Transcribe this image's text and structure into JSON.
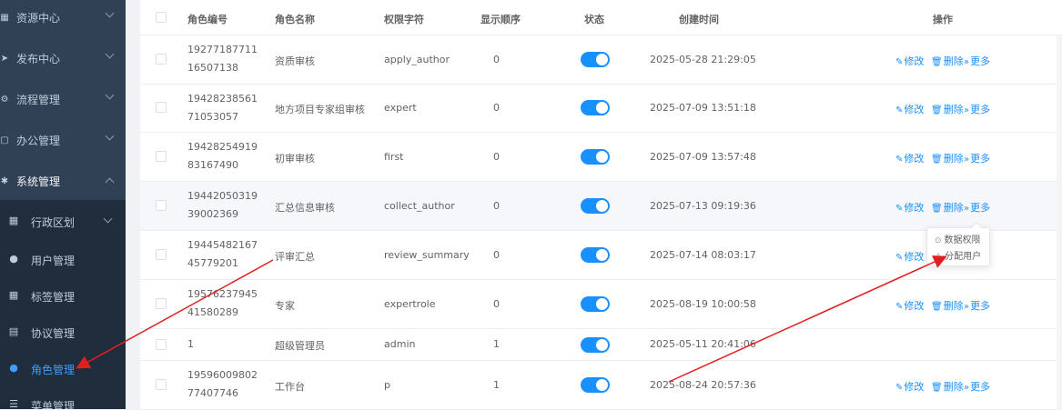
{
  "sidebar": {
    "items": [
      {
        "label": "资源中心",
        "icon": "grid-icon"
      },
      {
        "label": "发布中心",
        "icon": "send-icon"
      },
      {
        "label": "流程管理",
        "icon": "flow-icon"
      },
      {
        "label": "办公管理",
        "icon": "office-icon"
      },
      {
        "label": "系统管理",
        "icon": "gear-icon",
        "expanded": true
      }
    ],
    "sub_items": [
      {
        "label": "行政区划",
        "icon": "grid-icon"
      },
      {
        "label": "用户管理",
        "icon": "user-icon"
      },
      {
        "label": "标签管理",
        "icon": "grid-icon"
      },
      {
        "label": "协议管理",
        "icon": "document-icon"
      },
      {
        "label": "角色管理",
        "icon": "users-icon",
        "active": true
      },
      {
        "label": "菜单管理",
        "icon": "list-icon"
      }
    ]
  },
  "table": {
    "headers": {
      "id": "角色编号",
      "name": "角色名称",
      "key": "权限字符",
      "sort": "显示顺序",
      "status": "状态",
      "created": "创建时间",
      "actions": "操作"
    },
    "rows": [
      {
        "id": "1927718771116507138",
        "name": "资质审核",
        "key": "apply_author",
        "sort": "0",
        "created": "2025-05-28 21:29:05",
        "status_on": true
      },
      {
        "id": "1942823856171053057",
        "name": "地方项目专家组审核",
        "key": "expert",
        "sort": "0",
        "created": "2025-07-09 13:51:18",
        "status_on": true
      },
      {
        "id": "1942825491983167490",
        "name": "初审审核",
        "key": "first",
        "sort": "0",
        "created": "2025-07-09 13:57:48",
        "status_on": true
      },
      {
        "id": "1944205031939002369",
        "name": "汇总信息审核",
        "key": "collect_author",
        "sort": "0",
        "created": "2025-07-13 09:19:36",
        "status_on": true
      },
      {
        "id": "1944548216745779201",
        "name": "评审汇总",
        "key": "review_summary",
        "sort": "0",
        "created": "2025-07-14 08:03:17",
        "status_on": true
      },
      {
        "id": "1957623794541580289",
        "name": "专家",
        "key": "expertrole",
        "sort": "0",
        "created": "2025-08-19 10:00:58",
        "status_on": true
      },
      {
        "id": "1",
        "name": "超级管理员",
        "key": "admin",
        "sort": "1",
        "created": "2025-05-11 20:41:06",
        "status_on": true
      },
      {
        "id": "1959600980277407746",
        "name": "工作台",
        "key": "p",
        "sort": "1",
        "created": "2025-08-24 20:57:36",
        "status_on": true
      }
    ],
    "actions": {
      "edit": "修改",
      "delete": "删除",
      "more": "更多"
    }
  },
  "more_menu": {
    "items": [
      "数据权限",
      "分配用户"
    ]
  },
  "colors": {
    "sidebar_bg": "#304156",
    "submenu_bg": "#1f2d3d",
    "accent": "#1890ff",
    "annotation_arrow": "#e02020"
  }
}
